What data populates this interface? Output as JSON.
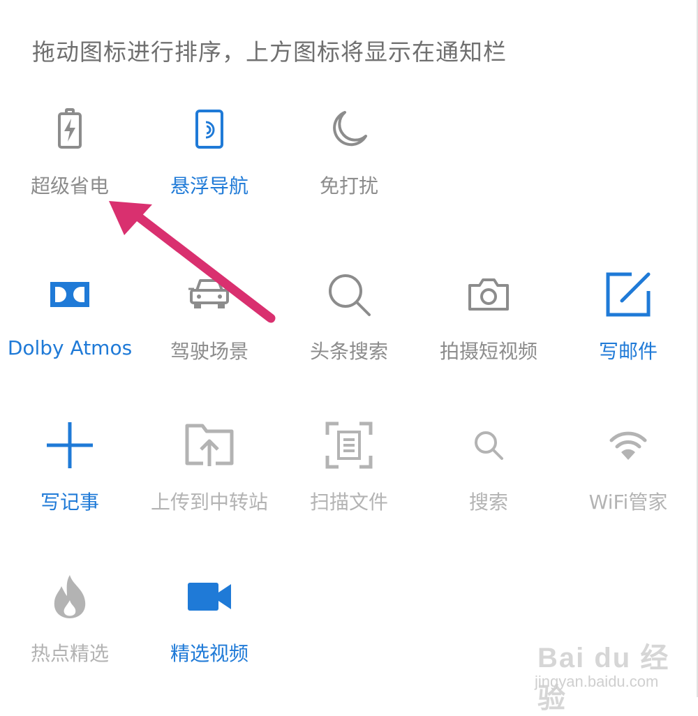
{
  "instruction": "拖动图标进行排序，上方图标将显示在通知栏",
  "colors": {
    "accent": "#1f7ad7",
    "muted": "#8c8c8c",
    "disabled": "#b3b3b3",
    "arrow": "#d9306f"
  },
  "pinned": [
    {
      "label": "超级省电",
      "icon": "battery-bolt-icon"
    },
    {
      "label": "悬浮导航",
      "icon": "floating-nav-icon"
    },
    {
      "label": "免打扰",
      "icon": "moon-icon"
    }
  ],
  "shortcuts": [
    {
      "label": "Dolby Atmos",
      "icon": "dolby-icon"
    },
    {
      "label": "驾驶场景",
      "icon": "car-icon"
    },
    {
      "label": "头条搜索",
      "icon": "search-icon"
    },
    {
      "label": "拍摄短视频",
      "icon": "camera-icon"
    },
    {
      "label": "写邮件",
      "icon": "compose-icon"
    },
    {
      "label": "写记事",
      "icon": "plus-icon"
    },
    {
      "label": "上传到中转站",
      "icon": "upload-folder-icon"
    },
    {
      "label": "扫描文件",
      "icon": "scan-document-icon"
    },
    {
      "label": "搜索",
      "icon": "small-search-icon"
    },
    {
      "label": "WiFi管家",
      "icon": "wifi-icon"
    },
    {
      "label": "热点精选",
      "icon": "flame-icon"
    },
    {
      "label": "精选视频",
      "icon": "video-camera-icon"
    }
  ],
  "watermark": {
    "brand": "Bai du 经验",
    "url": "jingyan.baidu.com"
  }
}
